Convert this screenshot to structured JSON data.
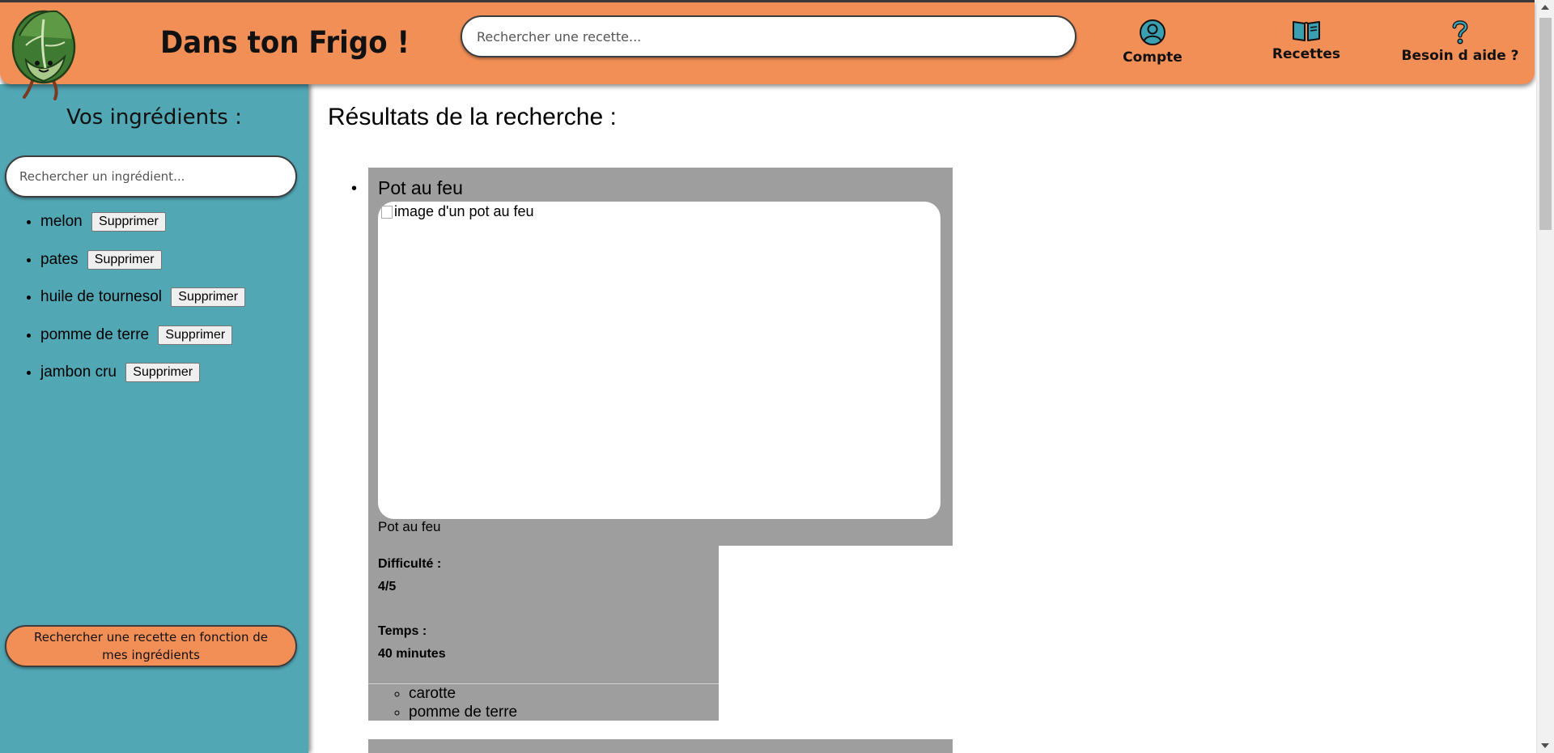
{
  "header": {
    "site_title": "Dans ton Frigo !",
    "logo_icon": "cabbage-mascot-icon",
    "recipe_search_placeholder": "Rechercher une recette...",
    "nav": [
      {
        "label": "Compte",
        "icon": "account-icon"
      },
      {
        "label": "Recettes",
        "icon": "book-icon"
      },
      {
        "label": "Besoin d aide ?",
        "icon": "question-icon"
      }
    ]
  },
  "sidebar": {
    "title": "Vos ingrédients :",
    "ingredient_search_placeholder": "Rechercher un ingrédient...",
    "ingredients": [
      {
        "name": "melon",
        "button": "Supprimer"
      },
      {
        "name": "pates",
        "button": "Supprimer"
      },
      {
        "name": "huile de tournesol",
        "button": "Supprimer"
      },
      {
        "name": "pomme de terre",
        "button": "Supprimer"
      },
      {
        "name": "jambon cru",
        "button": "Supprimer"
      }
    ],
    "search_button": "Rechercher une recette en fonction de mes ingrédients"
  },
  "main": {
    "results_title": "Résultats de la recherche :",
    "recipes": [
      {
        "name": "Pot au feu",
        "image_alt": "image d'un pot au feu",
        "caption": "Pot au feu",
        "difficulty_label": "Difficulté :",
        "difficulty_value": "4/5",
        "time_label": "Temps :",
        "time_value": "40 minutes",
        "ingredients": [
          "carotte",
          "pomme de terre"
        ]
      }
    ]
  },
  "colors": {
    "header_bg": "#f28f57",
    "sidebar_bg": "#52a7b5",
    "card_bg": "#9e9e9e",
    "icon_teal": "#3a9fb0"
  }
}
